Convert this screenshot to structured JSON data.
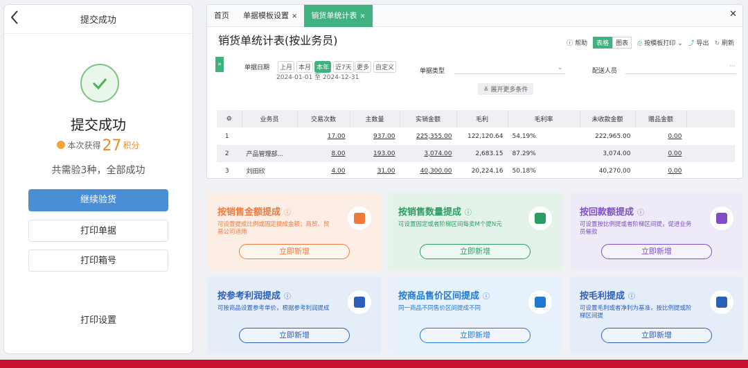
{
  "mobile": {
    "back_icon": "chevron-left-icon",
    "header_title": "提交成功",
    "success_title": "提交成功",
    "points_prefix": "本次获得",
    "points_value": "27",
    "points_unit": "积分",
    "summary": "共需验3种，全部成功",
    "buttons": {
      "continue": "继续验货",
      "print_doc": "打印单据",
      "print_box": "打印箱号"
    },
    "print_settings": "打印设置"
  },
  "tabs": [
    {
      "label": "首页",
      "closable": false,
      "active": false
    },
    {
      "label": "单据模板设置",
      "closable": true,
      "active": false
    },
    {
      "label": "销货单统计表",
      "closable": true,
      "active": true
    }
  ],
  "page": {
    "title": "销货单统计表(按业务员)",
    "toolbar": {
      "help": "帮助",
      "table": "表格",
      "chart": "图表",
      "template_print": "按模板打印",
      "export": "导出",
      "refresh": "刷新"
    }
  },
  "filters": {
    "date_label": "单据日期",
    "date_chips": [
      "上月",
      "本月",
      "本年",
      "近7天",
      "更多",
      "自定义"
    ],
    "active_chip": "本年",
    "date_range": "2024-01-01 至 2024-12-31",
    "doc_type_label": "单据类型",
    "doc_type_value": "",
    "delivery_label": "配送人员",
    "delivery_value": "",
    "more": "展开更多条件"
  },
  "table": {
    "headers": [
      "业务员",
      "交易次数",
      "主数量",
      "实销金额",
      "毛利",
      "毛利率",
      "未收款金额",
      "赠品金额"
    ],
    "rows": [
      {
        "no": "1",
        "person": "",
        "trades": "17.00",
        "qty": "937.00",
        "sales": "225,355.00",
        "profit": "122,120.64",
        "rate": "54.19%",
        "unpaid": "222,965.00",
        "gift": "0.00"
      },
      {
        "no": "2",
        "person": "产品管理部...",
        "trades": "8.00",
        "qty": "193.00",
        "sales": "3,074.00",
        "profit": "2,683.15",
        "rate": "87.29%",
        "unpaid": "3,074.00",
        "gift": "0.00"
      },
      {
        "no": "3",
        "person": "刘田欣",
        "trades": "4.00",
        "qty": "31.00",
        "sales": "40,300.00",
        "profit": "20,224.16",
        "rate": "50.18%",
        "unpaid": "40,270.00",
        "gift": "0.00"
      }
    ]
  },
  "cards": [
    {
      "title": "按销售金额提成",
      "desc": "可设置提成比例或固定提成金额；商贸、贸易公司适用",
      "button": "立即新增",
      "icon": "wallet-icon",
      "bg": "#fdeee5",
      "accent": "#ee7a3e"
    },
    {
      "title": "按销售数量提成",
      "desc": "可设置固定或者阶梯区间每卖M个提N元",
      "button": "立即新增",
      "icon": "package-upload-icon",
      "bg": "#e3f3ea",
      "accent": "#2e9d64"
    },
    {
      "title": "按回款额提成",
      "desc": "可设置按比例提或者阶梯区间提，促进业务员催款",
      "button": "立即新增",
      "icon": "calendar-money-icon",
      "bg": "#efeaf8",
      "accent": "#7c4fc7"
    },
    {
      "title": "按参考利润提成",
      "desc": "可按商品设置参考单价，根据参考利润提成",
      "button": "立即新增",
      "icon": "lock-chart-icon",
      "bg": "#e5edf9",
      "accent": "#2d5fb8"
    },
    {
      "title": "按商品售价区间提成",
      "desc": "同一商品不同售价区间提成不同",
      "button": "立即新增",
      "icon": "clipboard-icon",
      "bg": "#e6f1fb",
      "accent": "#2179d2"
    },
    {
      "title": "按毛利提成",
      "desc": "可设置毛利或者净利为基准，按比例提或阶梯区间提",
      "button": "立即新增",
      "icon": "money-bag-icon",
      "bg": "#e5edf9",
      "accent": "#2d5fb8"
    }
  ]
}
